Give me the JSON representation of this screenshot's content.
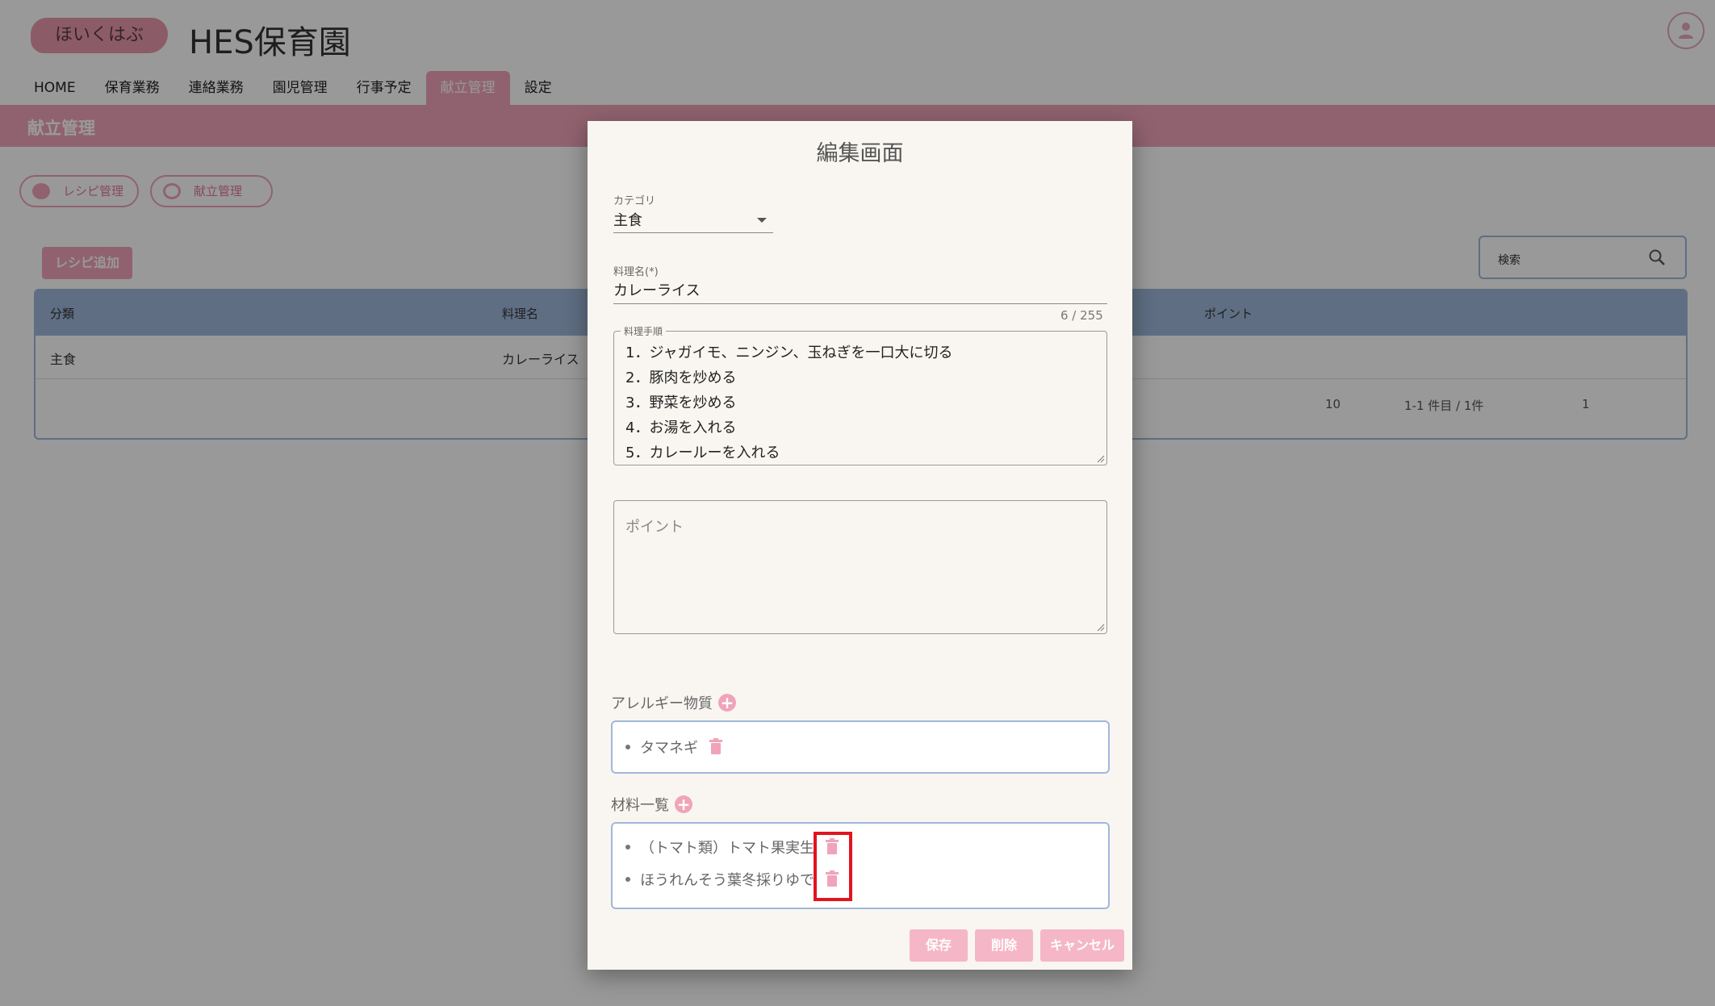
{
  "app": {
    "logo_text": "ほいくはぶ",
    "title": "HES保育園",
    "nav": [
      {
        "label": "HOME"
      },
      {
        "label": "保育業務"
      },
      {
        "label": "連絡業務"
      },
      {
        "label": "園児管理"
      },
      {
        "label": "行事予定"
      },
      {
        "label": "献立管理",
        "active": true
      },
      {
        "label": "設定"
      }
    ],
    "page_heading": "献立管理",
    "subnav": {
      "recipe": "レシピ管理",
      "menu": "献立管理"
    },
    "add_recipe_label": "レシピ追加",
    "search_label": "検索",
    "table": {
      "headers": [
        "分類",
        "料理名",
        "ポイント"
      ],
      "rows": [
        {
          "category": "主食",
          "name": "カレーライス"
        }
      ]
    },
    "pagination": {
      "per_page": "10",
      "range": "1-1 件目 / 1件",
      "page": "1"
    }
  },
  "dialog": {
    "title": "編集画面",
    "category": {
      "label": "カテゴリ",
      "value": "主食"
    },
    "dish_name": {
      "label": "料理名(*)",
      "value": "カレーライス",
      "counter": "6 / 255"
    },
    "steps": {
      "label": "料理手順",
      "lines": [
        "1．ジャガイモ、ニンジン、玉ねぎを一口大に切る",
        "2．豚肉を炒める",
        "3．野菜を炒める",
        "4．お湯を入れる",
        "5．カレールーを入れる"
      ]
    },
    "point": {
      "placeholder": "ポイント"
    },
    "allergens": {
      "label": "アレルギー物質",
      "items": [
        "タマネギ"
      ]
    },
    "ingredients": {
      "label": "材料一覧",
      "items": [
        "（トマト類）トマト果実生",
        "ほうれんそう葉冬採りゆで"
      ]
    },
    "buttons": {
      "save": "保存",
      "delete": "削除",
      "cancel": "キャンセル"
    }
  },
  "colors": {
    "accent_pink": "#f0a4b9",
    "table_blue": "#9fb8db",
    "highlight_red": "#e0141f"
  }
}
